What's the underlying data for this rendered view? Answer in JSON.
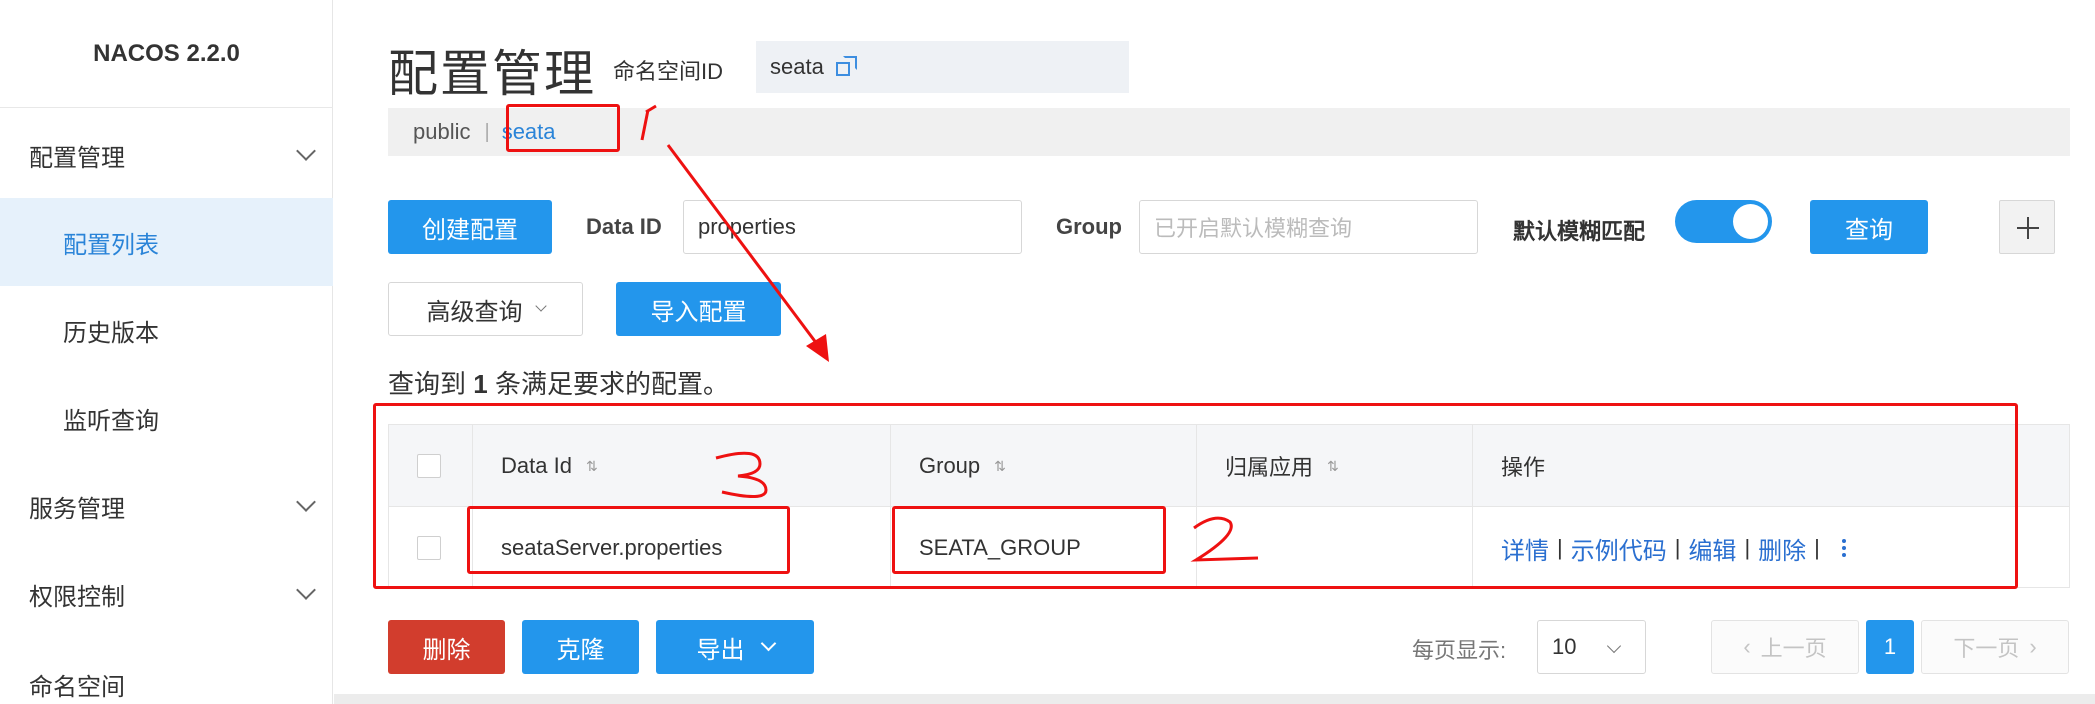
{
  "sidebar": {
    "brand": "NACOS 2.2.0",
    "items": [
      {
        "label": "配置管理"
      },
      {
        "label": "配置列表"
      },
      {
        "label": "历史版本"
      },
      {
        "label": "监听查询"
      },
      {
        "label": "服务管理"
      },
      {
        "label": "权限控制"
      },
      {
        "label": "命名空间"
      }
    ]
  },
  "header": {
    "title": "配置管理",
    "namespace_label": "命名空间ID",
    "namespace_value": "seata"
  },
  "namespaces": {
    "items": [
      "public",
      "seata"
    ],
    "separator": "|",
    "selected": "seata"
  },
  "search": {
    "create_button": "创建配置",
    "data_id_label": "Data ID",
    "data_id_value": "properties",
    "group_label": "Group",
    "group_placeholder": "已开启默认模糊查询",
    "fuzzy_label": "默认模糊匹配",
    "fuzzy_enabled": true,
    "query_button": "查询",
    "advanced_button": "高级查询",
    "import_button": "导入配置"
  },
  "result": {
    "prefix": "查询到",
    "count": "1",
    "suffix": "条满足要求的配置。"
  },
  "table": {
    "columns": [
      "Data Id",
      "Group",
      "归属应用",
      "操作"
    ],
    "sort_icon": "⇅",
    "rows": [
      {
        "data_id": "seataServer.properties",
        "group": "SEATA_GROUP",
        "app": ""
      }
    ],
    "actions": [
      "详情",
      "示例代码",
      "编辑",
      "删除"
    ],
    "action_separator": "|"
  },
  "footer": {
    "delete_button": "删除",
    "clone_button": "克隆",
    "export_button": "导出",
    "per_page_label": "每页显示:",
    "page_size": "10",
    "prev": "上一页",
    "next": "下一页",
    "current_page": "1"
  },
  "annotations": {
    "numbers": [
      "1",
      "2",
      "3"
    ],
    "color": "#ee1111"
  },
  "colors": {
    "primary": "#2396ec",
    "danger": "#d23d2d",
    "link": "#2a6fd0",
    "active_bg": "#e6f1fb"
  }
}
